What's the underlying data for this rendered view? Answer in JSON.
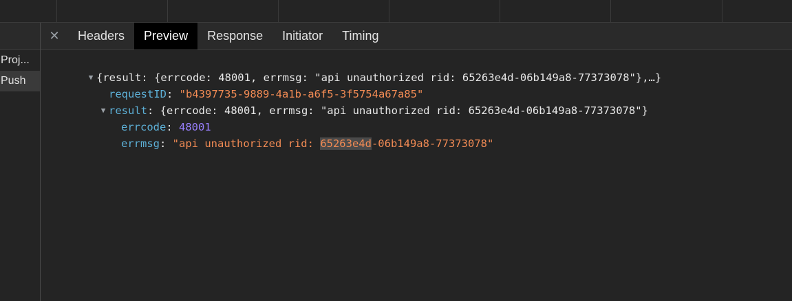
{
  "tabs": {
    "close_icon": "close-icon",
    "items": [
      "Headers",
      "Preview",
      "Response",
      "Initiator",
      "Timing"
    ],
    "active": "Preview"
  },
  "requests": {
    "items": [
      "Proj...",
      "Push"
    ]
  },
  "preview": {
    "root_summary": "{result: {errcode: 48001, errmsg: \"api unauthorized rid: 65263e4d-06b149a8-77373078\"},…}",
    "request_id_key": "requestID",
    "request_id_value": "\"b4397735-9889-4a1b-a6f5-3f5754a67a85\"",
    "result_key": "result",
    "result_summary": "{errcode: 48001, errmsg: \"api unauthorized rid: 65263e4d-06b149a8-77373078\"}",
    "errcode_key": "errcode",
    "errcode_value": "48001",
    "errmsg_key": "errmsg",
    "errmsg_prefix": "\"api unauthorized rid: ",
    "errmsg_highlight": "65263e4d",
    "errmsg_suffix": "-06b149a8-77373078\""
  },
  "colors": {
    "key": "#5db0d7",
    "string": "#f28b54",
    "number": "#9980ff",
    "active_tab_bg": "#000000"
  }
}
